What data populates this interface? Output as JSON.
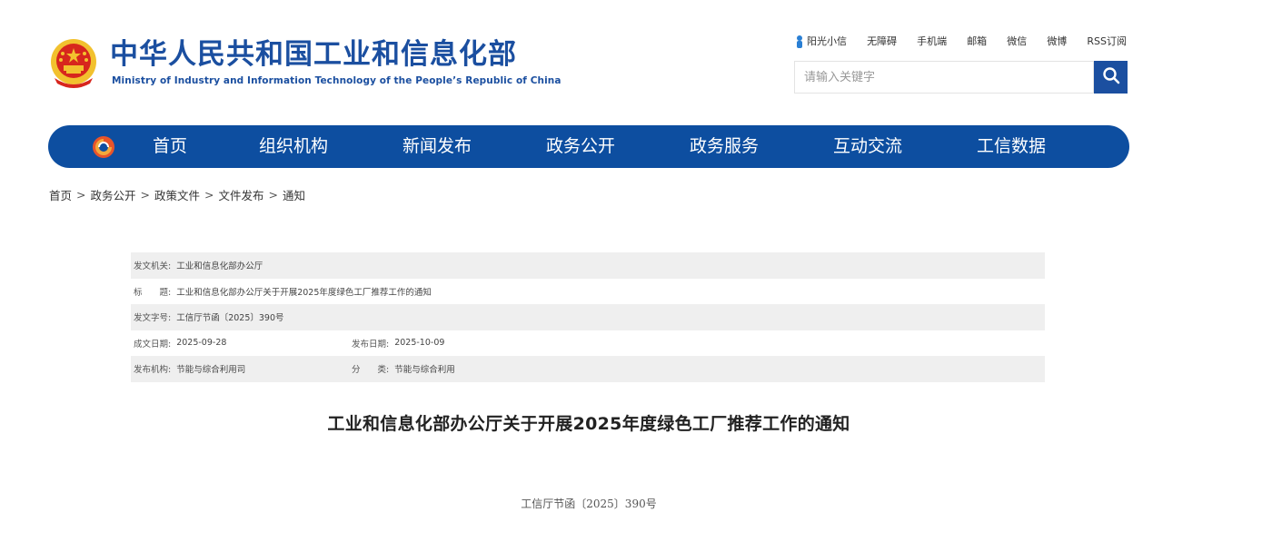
{
  "header": {
    "site_title_cn": "中华人民共和国工业和信息化部",
    "site_title_en": "Ministry of Industry and Information Technology of the People’s Republic of China",
    "emblem_icon": "national-emblem-icon"
  },
  "toplinks": [
    {
      "label": "阳光小信",
      "icon": "mini-assistant-icon"
    },
    {
      "label": "无障碍"
    },
    {
      "label": "手机端"
    },
    {
      "label": "邮箱"
    },
    {
      "label": "微信"
    },
    {
      "label": "微博"
    },
    {
      "label": "RSS订阅"
    }
  ],
  "search": {
    "placeholder": "请输入关键字",
    "button_icon": "search-icon"
  },
  "nav": {
    "logo_icon": "nav-logo-icon",
    "items": [
      {
        "label": "首页"
      },
      {
        "label": "组织机构"
      },
      {
        "label": "新闻发布"
      },
      {
        "label": "政务公开"
      },
      {
        "label": "政务服务"
      },
      {
        "label": "互动交流"
      },
      {
        "label": "工信数据"
      }
    ]
  },
  "breadcrumb": {
    "items": [
      "首页",
      "政务公开",
      "政策文件",
      "文件发布",
      "通知"
    ],
    "separator": ">"
  },
  "meta": {
    "issuer_key": "发文机关:",
    "issuer_val": "工业和信息化部办公厅",
    "title_key": "标　　题:",
    "title_val": "工业和信息化部办公厅关于开展2025年度绿色工厂推荐工作的通知",
    "docno_key": "发文字号:",
    "docno_val": "工信厅节函〔2025〕390号",
    "written_key": "成文日期:",
    "written_val": "2025-09-28",
    "published_key": "发布日期:",
    "published_val": "2025-10-09",
    "org_key": "发布机构:",
    "org_val": "节能与综合利用司",
    "category_key": "分　　类:",
    "category_val": "节能与综合利用"
  },
  "document": {
    "title": "工业和信息化部办公厅关于开展2025年度绿色工厂推荐工作的通知",
    "number": "工信厅节函〔2025〕390号"
  },
  "colors": {
    "brand_blue": "#1b4fa0",
    "nav_blue": "#0d4ea0",
    "emblem_red": "#d7261d",
    "emblem_gold": "#f2c12e",
    "row_shade": "#efefef"
  }
}
